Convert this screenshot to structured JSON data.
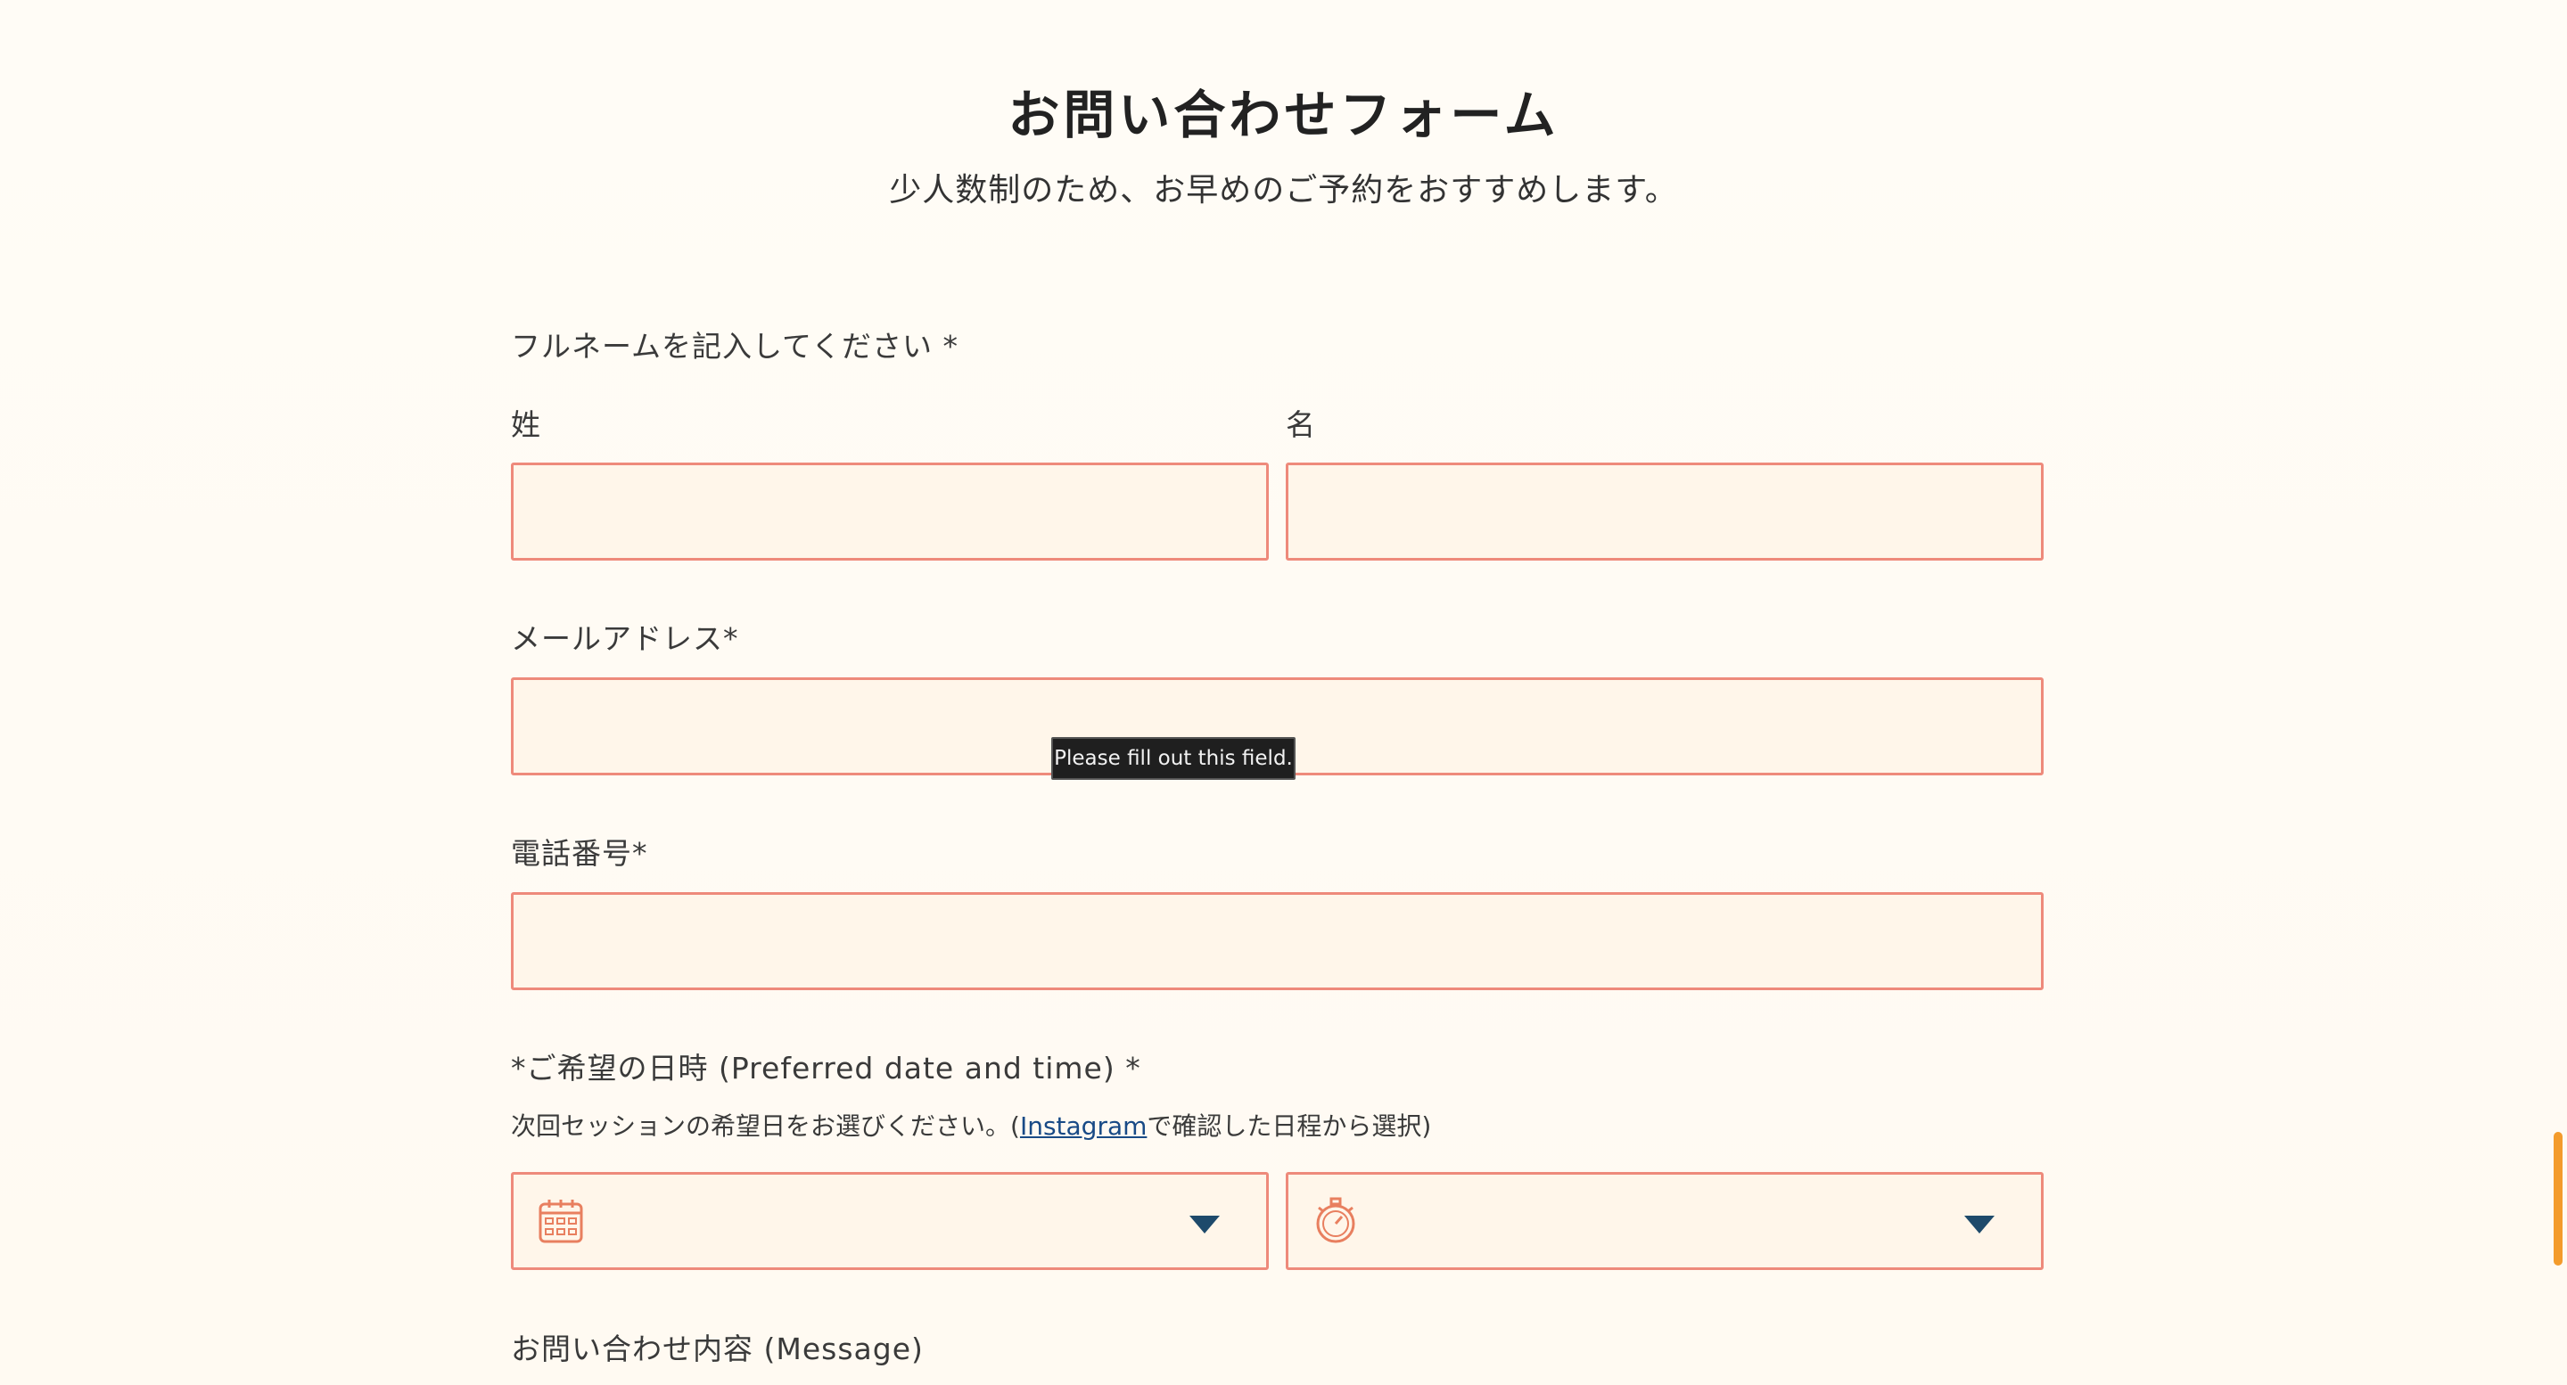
{
  "form": {
    "title": "お問い合わせフォーム",
    "subtitle": "少人数制のため、お早めのご予約をおすすめします。",
    "fullname_label": "フルネームを記入してください *",
    "last_name_label": "姓",
    "first_name_label": "名",
    "email_label": "メールアドレス*",
    "phone_label": "電話番号*",
    "datetime_label": "*ご希望の日時 (Preferred date and time) *",
    "datetime_help_prefix": "次回セッションの希望日をお選びください。(",
    "datetime_help_link": "Instagram",
    "datetime_help_suffix": "で確認した日程から選択)",
    "message_label": "お問い合わせ内容 (Message)",
    "last_name_value": "",
    "first_name_value": "",
    "email_value": "",
    "phone_value": ""
  },
  "tooltip": {
    "text": "Please fill out this field."
  },
  "icons": {
    "date": "calendar-icon",
    "time": "stopwatch-icon",
    "dropdown": "chevron-down-icon"
  },
  "colors": {
    "field_border": "#ee8a7b",
    "field_background": "#fff6ea",
    "icon_accent": "#e87f5f",
    "caret": "#1e4a6b",
    "link": "#184a86",
    "scrollbar": "#f39b2c"
  }
}
